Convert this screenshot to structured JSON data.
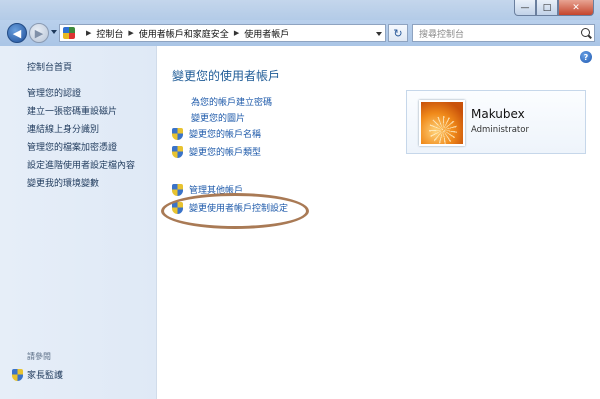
{
  "window": {
    "minimize_glyph": "—",
    "maximize_glyph": "□",
    "close_glyph": "✕"
  },
  "nav": {
    "breadcrumbs": [
      "控制台",
      "使用者帳戶和家庭安全",
      "使用者帳戶"
    ],
    "search_placeholder": "搜尋控制台",
    "refresh_glyph": "↻"
  },
  "sidebar": {
    "items": [
      {
        "label": "控制台首頁"
      },
      {
        "label": "管理您的認證"
      },
      {
        "label": "建立一張密碼重設磁片"
      },
      {
        "label": "連結線上身分識別"
      },
      {
        "label": "管理您的檔案加密憑證"
      },
      {
        "label": "設定進階使用者設定檔內容"
      },
      {
        "label": "變更我的環境變數"
      }
    ],
    "see_also": "請參閱",
    "family_safety": "家長監護"
  },
  "main": {
    "title": "變更您的使用者帳戶",
    "tasks": [
      {
        "label": "為您的帳戶建立密碼",
        "shield": false
      },
      {
        "label": "變更您的圖片",
        "shield": false
      },
      {
        "label": "變更您的帳戶名稱",
        "shield": true
      },
      {
        "label": "變更您的帳戶類型",
        "shield": true
      }
    ],
    "other_tasks": [
      {
        "label": "管理其他帳戶",
        "shield": true
      },
      {
        "label": "變更使用者帳戶控制設定",
        "shield": true
      }
    ],
    "help_glyph": "?"
  },
  "user": {
    "name": "Makubex",
    "role": "Administrator"
  },
  "icons": {
    "back": "back-arrow-icon",
    "forward": "forward-arrow-icon",
    "search": "search-icon",
    "uac": "uac-shield-icon",
    "help": "help-icon"
  },
  "colors": {
    "link": "#1e5aaa",
    "title": "#1e5b96",
    "highlight_ring": "#a97a55"
  }
}
